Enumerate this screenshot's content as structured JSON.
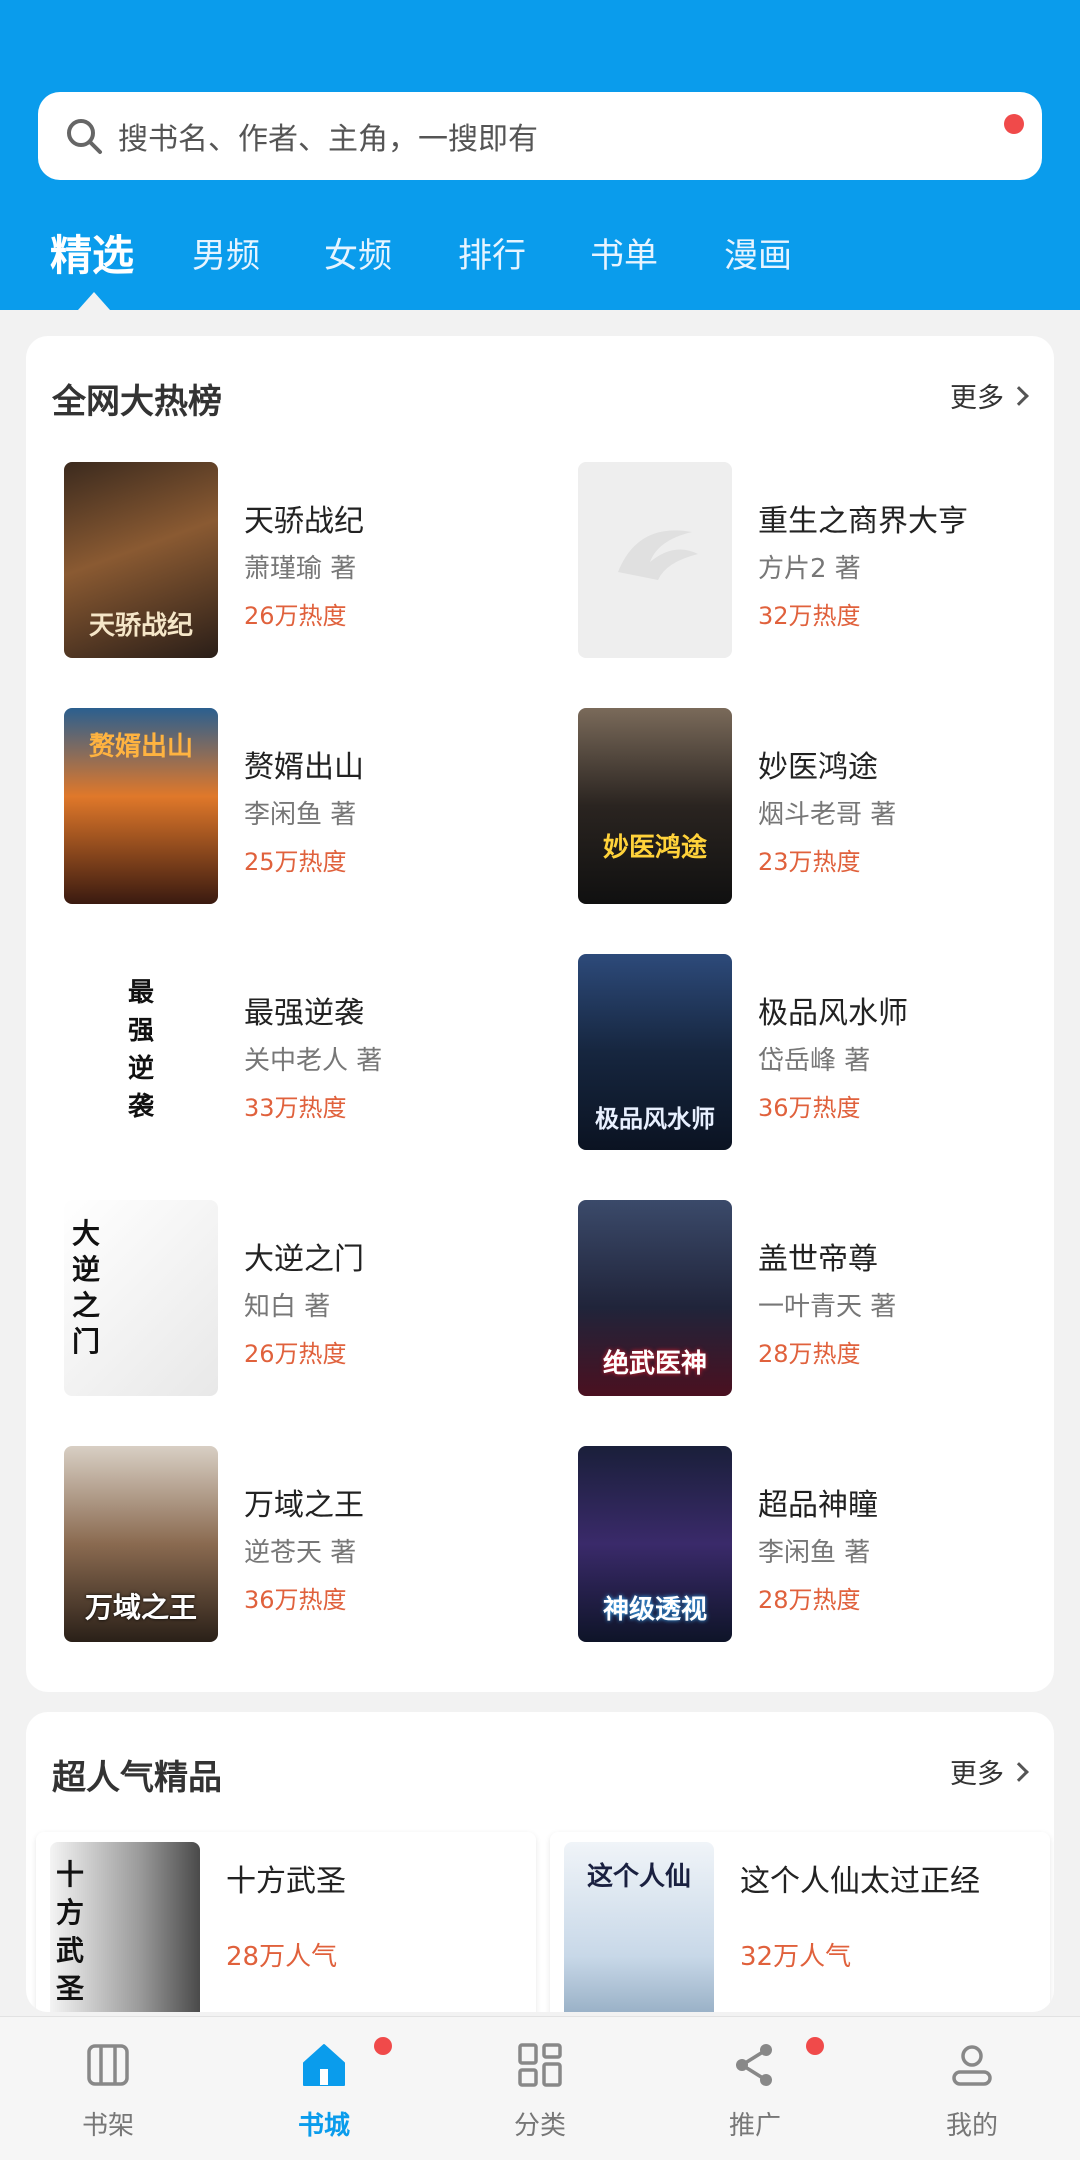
{
  "colors": {
    "brand": "#0a9cec",
    "heat": "#e0613c",
    "badge": "#f04a4a"
  },
  "search": {
    "placeholder": "搜书名、作者、主角，一搜即有"
  },
  "tabs": [
    "精选",
    "男频",
    "女频",
    "排行",
    "书单",
    "漫画"
  ],
  "active_tab": "精选",
  "hot_list": {
    "title": "全网大热榜",
    "more": "更多",
    "books": [
      {
        "title": "天骄战纪",
        "author": "萧瑾瑜 著",
        "heat": "26万热度",
        "cover_text": "天骄战纪"
      },
      {
        "title": "重生之商界大亨",
        "author": "方片2 著",
        "heat": "32万热度",
        "cover_text": ""
      },
      {
        "title": "赘婿出山",
        "author": "李闲鱼 著",
        "heat": "25万热度",
        "cover_text": "赘婿出山"
      },
      {
        "title": "妙医鸿途",
        "author": "烟斗老哥 著",
        "heat": "23万热度",
        "cover_text": "妙医鸿途"
      },
      {
        "title": "最强逆袭",
        "author": "关中老人 著",
        "heat": "33万热度",
        "cover_text": "最强逆袭"
      },
      {
        "title": "极品风水师",
        "author": "岱岳峰 著",
        "heat": "36万热度",
        "cover_text": "极品风水师"
      },
      {
        "title": "大逆之门",
        "author": "知白 著",
        "heat": "26万热度",
        "cover_text": "大逆之门"
      },
      {
        "title": "盖世帝尊",
        "author": "一叶青天 著",
        "heat": "28万热度",
        "cover_text": "绝武医神"
      },
      {
        "title": "万域之王",
        "author": "逆苍天 著",
        "heat": "36万热度",
        "cover_text": "万域之王"
      },
      {
        "title": "超品神瞳",
        "author": "李闲鱼 著",
        "heat": "28万热度",
        "cover_text": "神级透视"
      }
    ]
  },
  "popular": {
    "title": "超人气精品",
    "more": "更多",
    "books": [
      {
        "title": "十方武圣",
        "heat": "28万人气",
        "cover_text": "十方武圣"
      },
      {
        "title": "这个人仙太过正经",
        "heat": "32万人气",
        "cover_text": "这个人仙"
      }
    ]
  },
  "tabbar": {
    "items": [
      {
        "label": "书架",
        "icon": "bookshelf-icon"
      },
      {
        "label": "书城",
        "icon": "home-icon"
      },
      {
        "label": "分类",
        "icon": "category-icon"
      },
      {
        "label": "推广",
        "icon": "share-icon"
      },
      {
        "label": "我的",
        "icon": "user-icon"
      }
    ],
    "active": "书城"
  }
}
